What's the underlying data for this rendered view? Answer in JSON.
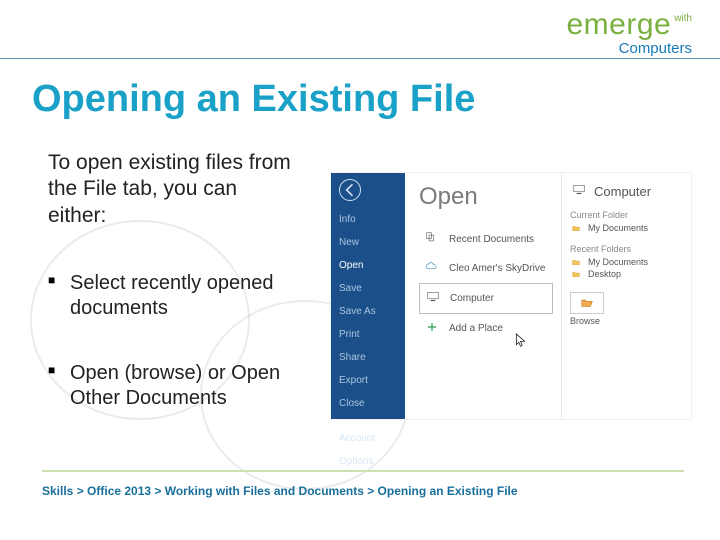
{
  "brand": {
    "word1": "emerge",
    "word2": "with",
    "word3": "Computers"
  },
  "title": "Opening an Existing File",
  "intro": "To open existing files from the File tab, you can either:",
  "bullets": [
    "Select recently opened documents",
    "Open (browse) or Open Other Documents"
  ],
  "screenshot": {
    "sidebar": {
      "items": [
        "Info",
        "New",
        "Open",
        "Save",
        "Save As",
        "Print",
        "Share",
        "Export",
        "Close",
        "",
        "Account",
        "Options"
      ],
      "selected": "Open"
    },
    "mid": {
      "heading": "Open",
      "rows": [
        {
          "label": "Recent Documents"
        },
        {
          "label": "Cleo Amer's SkyDrive"
        },
        {
          "label": "Computer",
          "selected": true
        },
        {
          "label": "Add a Place"
        }
      ]
    },
    "right": {
      "heading": "Computer",
      "current_folder_label": "Current Folder",
      "current_folder": "My Documents",
      "recent_folders_label": "Recent Folders",
      "recent_folders": [
        "My Documents",
        "Desktop"
      ],
      "browse_label": "Browse"
    }
  },
  "breadcrumb": "Skills > Office 2013 > Working with Files and Documents > Opening an Existing File"
}
